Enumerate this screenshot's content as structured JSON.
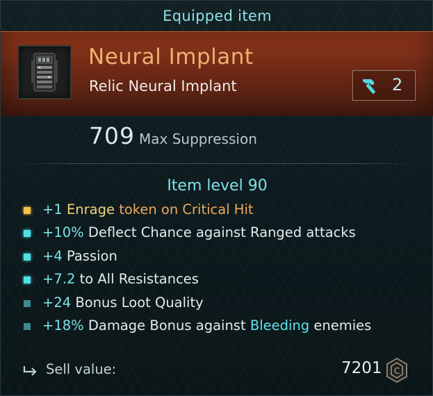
{
  "header": {
    "title": "Equipped item"
  },
  "item": {
    "name": "Neural Implant",
    "type": "Relic Neural Implant",
    "icon": "neural-implant-icon",
    "tier_icon": "hammer-icon",
    "tier_value": "2",
    "rarity_color": "#f0b070"
  },
  "main_stat": {
    "value": "709",
    "label": "Max Suppression"
  },
  "item_level": "Item level 90",
  "affixes": [
    {
      "bullet": "gold",
      "parts": [
        {
          "text": "+1 ",
          "cls": "c-val"
        },
        {
          "text": "Enrage ",
          "cls": "c-gold"
        },
        {
          "text": "token on Critical Hit",
          "cls": "c-orange"
        }
      ]
    },
    {
      "bullet": "cyan",
      "parts": [
        {
          "text": "+10% ",
          "cls": "c-val"
        },
        {
          "text": "Deflect Chance against Ranged attacks",
          "cls": "c-white"
        }
      ]
    },
    {
      "bullet": "cyan",
      "parts": [
        {
          "text": "+4 ",
          "cls": "c-val"
        },
        {
          "text": "Passion",
          "cls": "c-white"
        }
      ]
    },
    {
      "bullet": "cyan",
      "parts": [
        {
          "text": "+7.2 ",
          "cls": "c-val"
        },
        {
          "text": "to All Resistances",
          "cls": "c-white"
        }
      ]
    },
    {
      "bullet": "dim",
      "parts": [
        {
          "text": "+24 ",
          "cls": "c-val"
        },
        {
          "text": "Bonus Loot Quality",
          "cls": "c-white"
        }
      ]
    },
    {
      "bullet": "dim",
      "parts": [
        {
          "text": "+18% ",
          "cls": "c-val"
        },
        {
          "text": "Damage Bonus against ",
          "cls": "c-white"
        },
        {
          "text": "Bleeding",
          "cls": "c-cyan"
        },
        {
          "text": " enemies",
          "cls": "c-white"
        }
      ]
    }
  ],
  "footer": {
    "sell_icon": "sell-arrow-icon",
    "sell_label": "Sell value:",
    "sell_value": "7201",
    "currency_icon": "scrap-currency-icon"
  }
}
